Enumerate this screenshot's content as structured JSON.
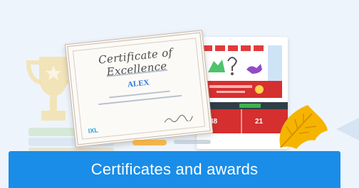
{
  "banner": {
    "label": "Certificates and awards"
  },
  "certificate": {
    "title": "Certificate of Excellence",
    "recipient_name": "ALEX",
    "logo_text": "IXL"
  },
  "report": {
    "stat_left": "48",
    "stat_right": "21"
  },
  "colors": {
    "background": "#eef4fb",
    "banner": "#1a8de8",
    "report_red": "#d62f2f",
    "leaf": "#f5b400"
  }
}
